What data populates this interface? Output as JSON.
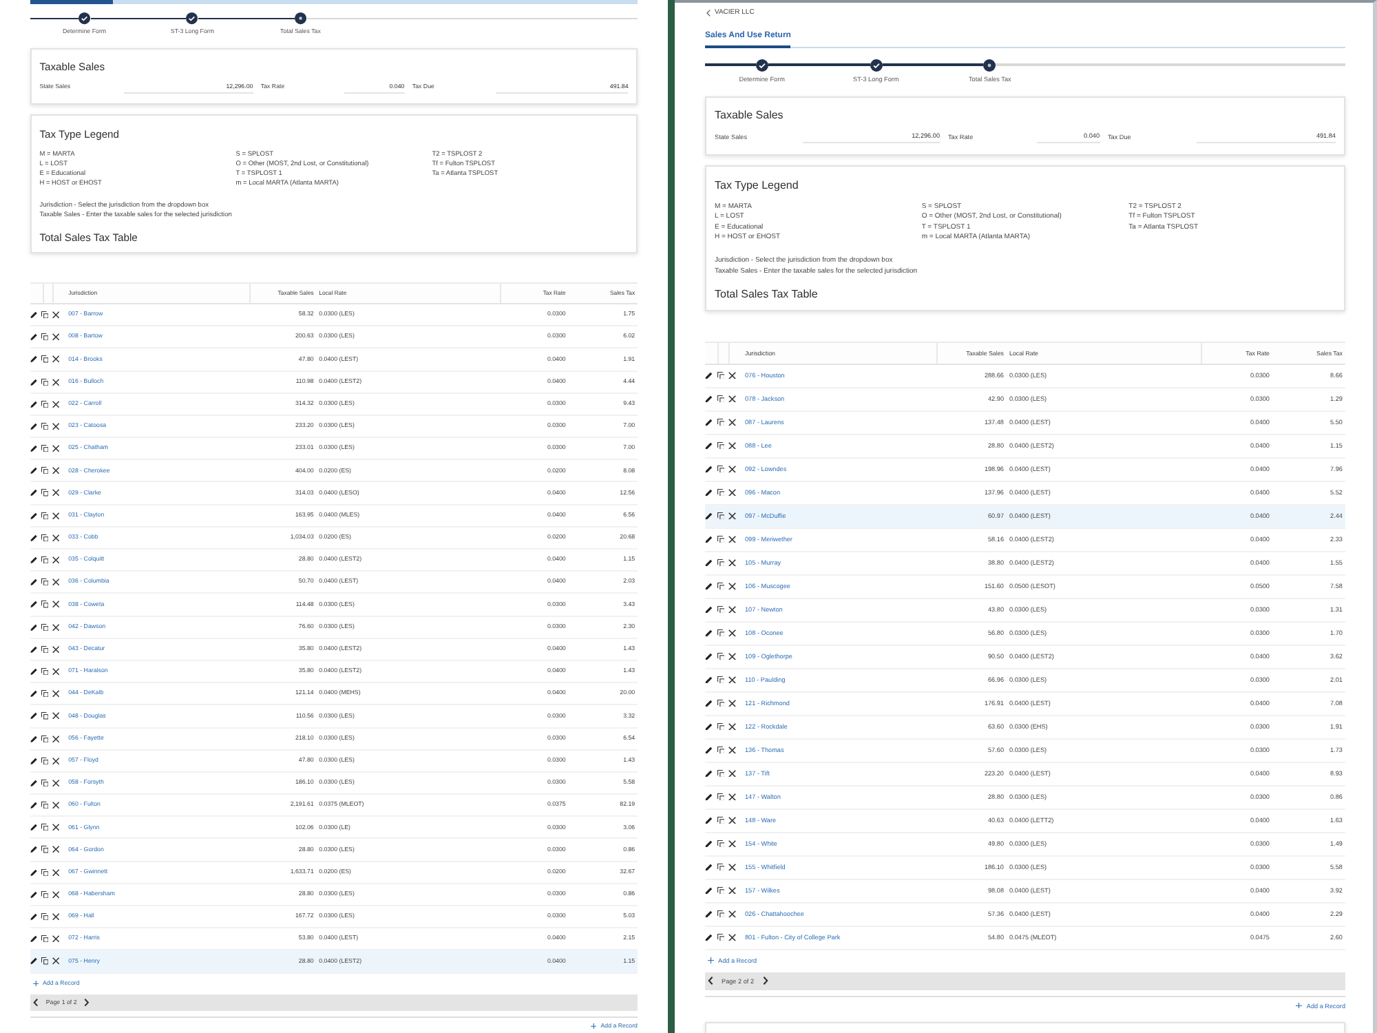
{
  "panels": [
    {
      "steps": [
        {
          "label": "Determine Form",
          "completed": true
        },
        {
          "label": "ST-3 Long Form",
          "completed": true
        },
        {
          "label": "Total Sales Tax",
          "completed": false
        }
      ],
      "taxable_sales": {
        "title": "Taxable Sales",
        "fields": [
          {
            "label": "State Sales",
            "value": "12,296.00"
          },
          {
            "label": "Tax Rate",
            "value": "0.040"
          },
          {
            "label": "Tax Due",
            "value": "491.84"
          }
        ]
      },
      "legend": {
        "title": "Tax Type Legend",
        "columns": [
          [
            "M = MARTA",
            "L = LOST",
            "E = Educational",
            "H = HOST or EHOST"
          ],
          [
            "S = SPLOST",
            "O = Other (MOST, 2nd Lost, or Constitutional)",
            "T = TSPLOST 1",
            "m = Local MARTA (Atlanta MARTA)"
          ],
          [
            "T2 = TSPLOST 2",
            "Tf = Fulton TSPLOST",
            "Ta = Atlanta TSPLOST"
          ]
        ],
        "notes": [
          "Jurisdiction - Select the jurisdiction from the dropdown box",
          "Taxable Sales - Enter the taxable sales for the selected jurisdiction"
        ],
        "table_title": "Total Sales Tax Table"
      },
      "table": {
        "columns": [
          "Jurisdiction",
          "Taxable Sales",
          "Local Rate",
          "Tax Rate",
          "Sales Tax"
        ],
        "rows": [
          {
            "jurisdiction": "007 - Barrow",
            "taxable_sales": "58.32",
            "local_rate": "0.0300 (LES)",
            "tax_rate": "0.0300",
            "sales_tax": "1.75",
            "selected": false
          },
          {
            "jurisdiction": "008 - Bartow",
            "taxable_sales": "200.63",
            "local_rate": "0.0300 (LES)",
            "tax_rate": "0.0300",
            "sales_tax": "6.02",
            "selected": false
          },
          {
            "jurisdiction": "014 - Brooks",
            "taxable_sales": "47.80",
            "local_rate": "0.0400 (LEST)",
            "tax_rate": "0.0400",
            "sales_tax": "1.91",
            "selected": false
          },
          {
            "jurisdiction": "016 - Bulloch",
            "taxable_sales": "110.98",
            "local_rate": "0.0400 (LEST2)",
            "tax_rate": "0.0400",
            "sales_tax": "4.44",
            "selected": false
          },
          {
            "jurisdiction": "022 - Carroll",
            "taxable_sales": "314.32",
            "local_rate": "0.0300 (LES)",
            "tax_rate": "0.0300",
            "sales_tax": "9.43",
            "selected": false
          },
          {
            "jurisdiction": "023 - Catoosa",
            "taxable_sales": "233.20",
            "local_rate": "0.0300 (LES)",
            "tax_rate": "0.0300",
            "sales_tax": "7.00",
            "selected": false
          },
          {
            "jurisdiction": "025 - Chatham",
            "taxable_sales": "233.01",
            "local_rate": "0.0300 (LES)",
            "tax_rate": "0.0300",
            "sales_tax": "7.00",
            "selected": false
          },
          {
            "jurisdiction": "028 - Cherokee",
            "taxable_sales": "404.00",
            "local_rate": "0.0200 (ES)",
            "tax_rate": "0.0200",
            "sales_tax": "8.08",
            "selected": false
          },
          {
            "jurisdiction": "029 - Clarke",
            "taxable_sales": "314.03",
            "local_rate": "0.0400 (LESO)",
            "tax_rate": "0.0400",
            "sales_tax": "12.56",
            "selected": false
          },
          {
            "jurisdiction": "031 - Clayton",
            "taxable_sales": "163.95",
            "local_rate": "0.0400 (MLES)",
            "tax_rate": "0.0400",
            "sales_tax": "6.56",
            "selected": false
          },
          {
            "jurisdiction": "033 - Cobb",
            "taxable_sales": "1,034.03",
            "local_rate": "0.0200 (ES)",
            "tax_rate": "0.0200",
            "sales_tax": "20.68",
            "selected": false
          },
          {
            "jurisdiction": "035 - Colquitt",
            "taxable_sales": "28.80",
            "local_rate": "0.0400 (LEST2)",
            "tax_rate": "0.0400",
            "sales_tax": "1.15",
            "selected": false
          },
          {
            "jurisdiction": "036 - Columbia",
            "taxable_sales": "50.70",
            "local_rate": "0.0400 (LEST)",
            "tax_rate": "0.0400",
            "sales_tax": "2.03",
            "selected": false
          },
          {
            "jurisdiction": "038 - Coweta",
            "taxable_sales": "114.48",
            "local_rate": "0.0300 (LES)",
            "tax_rate": "0.0300",
            "sales_tax": "3.43",
            "selected": false
          },
          {
            "jurisdiction": "042 - Dawson",
            "taxable_sales": "76.60",
            "local_rate": "0.0300 (LES)",
            "tax_rate": "0.0300",
            "sales_tax": "2.30",
            "selected": false
          },
          {
            "jurisdiction": "043 - Decatur",
            "taxable_sales": "35.80",
            "local_rate": "0.0400 (LEST2)",
            "tax_rate": "0.0400",
            "sales_tax": "1.43",
            "selected": false
          },
          {
            "jurisdiction": "071 - Haralson",
            "taxable_sales": "35.80",
            "local_rate": "0.0400 (LEST2)",
            "tax_rate": "0.0400",
            "sales_tax": "1.43",
            "selected": false
          },
          {
            "jurisdiction": "044 - DeKalb",
            "taxable_sales": "121.14",
            "local_rate": "0.0400 (MEHS)",
            "tax_rate": "0.0400",
            "sales_tax": "20.00",
            "selected": false
          },
          {
            "jurisdiction": "048 - Douglas",
            "taxable_sales": "110.56",
            "local_rate": "0.0300 (LES)",
            "tax_rate": "0.0300",
            "sales_tax": "3.32",
            "selected": false
          },
          {
            "jurisdiction": "056 - Fayette",
            "taxable_sales": "218.10",
            "local_rate": "0.0300 (LES)",
            "tax_rate": "0.0300",
            "sales_tax": "6.54",
            "selected": false
          },
          {
            "jurisdiction": "057 - Floyd",
            "taxable_sales": "47.80",
            "local_rate": "0.0300 (LES)",
            "tax_rate": "0.0300",
            "sales_tax": "1.43",
            "selected": false
          },
          {
            "jurisdiction": "058 - Forsyth",
            "taxable_sales": "186.10",
            "local_rate": "0.0300 (LES)",
            "tax_rate": "0.0300",
            "sales_tax": "5.58",
            "selected": false
          },
          {
            "jurisdiction": "060 - Fulton",
            "taxable_sales": "2,191.61",
            "local_rate": "0.0375 (MLEOT)",
            "tax_rate": "0.0375",
            "sales_tax": "82.19",
            "selected": false
          },
          {
            "jurisdiction": "061 - Glynn",
            "taxable_sales": "102.06",
            "local_rate": "0.0300 (LE)",
            "tax_rate": "0.0300",
            "sales_tax": "3.06",
            "selected": false
          },
          {
            "jurisdiction": "064 - Gordon",
            "taxable_sales": "28.80",
            "local_rate": "0.0300 (LES)",
            "tax_rate": "0.0300",
            "sales_tax": "0.86",
            "selected": false
          },
          {
            "jurisdiction": "067 - Gwinnett",
            "taxable_sales": "1,633.71",
            "local_rate": "0.0200 (ES)",
            "tax_rate": "0.0200",
            "sales_tax": "32.67",
            "selected": false
          },
          {
            "jurisdiction": "068 - Habersham",
            "taxable_sales": "28.80",
            "local_rate": "0.0300 (LES)",
            "tax_rate": "0.0300",
            "sales_tax": "0.86",
            "selected": false
          },
          {
            "jurisdiction": "069 - Hall",
            "taxable_sales": "167.72",
            "local_rate": "0.0300 (LES)",
            "tax_rate": "0.0300",
            "sales_tax": "5.03",
            "selected": false
          },
          {
            "jurisdiction": "072 - Harris",
            "taxable_sales": "53.80",
            "local_rate": "0.0400 (LEST)",
            "tax_rate": "0.0400",
            "sales_tax": "2.15",
            "selected": false
          },
          {
            "jurisdiction": "075 - Henry",
            "taxable_sales": "28.80",
            "local_rate": "0.0400 (LEST2)",
            "tax_rate": "0.0400",
            "sales_tax": "1.15",
            "selected": true
          }
        ],
        "add_link": "Add a Record",
        "pager": "Page 1 of 2"
      },
      "footer_link": "Add a Record"
    },
    {
      "back_link": "VACIER LLC",
      "tabs": [
        {
          "label": "Sales And Use Return",
          "selected": true
        }
      ],
      "steps": [
        {
          "label": "Determine Form",
          "completed": true
        },
        {
          "label": "ST-3 Long Form",
          "completed": true
        },
        {
          "label": "Total Sales Tax",
          "completed": false
        }
      ],
      "taxable_sales": {
        "title": "Taxable Sales",
        "fields": [
          {
            "label": "State Sales",
            "value": "12,296.00"
          },
          {
            "label": "Tax Rate",
            "value": "0.040"
          },
          {
            "label": "Tax Due",
            "value": "491.84"
          }
        ]
      },
      "legend": {
        "title": "Tax Type Legend",
        "columns": [
          [
            "M = MARTA",
            "L = LOST",
            "E = Educational",
            "H = HOST or EHOST"
          ],
          [
            "S = SPLOST",
            "O = Other (MOST, 2nd Lost, or Constitutional)",
            "T = TSPLOST 1",
            "m = Local MARTA (Atlanta MARTA)"
          ],
          [
            "T2 = TSPLOST 2",
            "Tf = Fulton TSPLOST",
            "Ta = Atlanta TSPLOST"
          ]
        ],
        "notes": [
          "Jurisdiction - Select the jurisdiction from the dropdown box",
          "Taxable Sales - Enter the taxable sales for the selected jurisdiction"
        ],
        "table_title": "Total Sales Tax Table"
      },
      "table": {
        "columns": [
          "Jurisdiction",
          "Taxable Sales",
          "Local Rate",
          "Tax Rate",
          "Sales Tax"
        ],
        "rows": [
          {
            "jurisdiction": "076 - Houston",
            "taxable_sales": "288.66",
            "local_rate": "0.0300 (LES)",
            "tax_rate": "0.0300",
            "sales_tax": "8.66",
            "selected": false
          },
          {
            "jurisdiction": "078 - Jackson",
            "taxable_sales": "42.90",
            "local_rate": "0.0300 (LES)",
            "tax_rate": "0.0300",
            "sales_tax": "1.29",
            "selected": false
          },
          {
            "jurisdiction": "087 - Laurens",
            "taxable_sales": "137.48",
            "local_rate": "0.0400 (LEST)",
            "tax_rate": "0.0400",
            "sales_tax": "5.50",
            "selected": false
          },
          {
            "jurisdiction": "088 - Lee",
            "taxable_sales": "28.80",
            "local_rate": "0.0400 (LEST2)",
            "tax_rate": "0.0400",
            "sales_tax": "1.15",
            "selected": false
          },
          {
            "jurisdiction": "092 - Lowndes",
            "taxable_sales": "198.96",
            "local_rate": "0.0400 (LEST)",
            "tax_rate": "0.0400",
            "sales_tax": "7.96",
            "selected": false
          },
          {
            "jurisdiction": "096 - Macon",
            "taxable_sales": "137.96",
            "local_rate": "0.0400 (LEST)",
            "tax_rate": "0.0400",
            "sales_tax": "5.52",
            "selected": false
          },
          {
            "jurisdiction": "097 - McDuffie",
            "taxable_sales": "60.97",
            "local_rate": "0.0400 (LEST)",
            "tax_rate": "0.0400",
            "sales_tax": "2.44",
            "selected": true
          },
          {
            "jurisdiction": "099 - Meriwether",
            "taxable_sales": "58.16",
            "local_rate": "0.0400 (LEST2)",
            "tax_rate": "0.0400",
            "sales_tax": "2.33",
            "selected": false
          },
          {
            "jurisdiction": "105 - Murray",
            "taxable_sales": "38.80",
            "local_rate": "0.0400 (LEST2)",
            "tax_rate": "0.0400",
            "sales_tax": "1.55",
            "selected": false
          },
          {
            "jurisdiction": "106 - Muscogee",
            "taxable_sales": "151.60",
            "local_rate": "0.0500 (LESOT)",
            "tax_rate": "0.0500",
            "sales_tax": "7.58",
            "selected": false
          },
          {
            "jurisdiction": "107 - Newton",
            "taxable_sales": "43.80",
            "local_rate": "0.0300 (LES)",
            "tax_rate": "0.0300",
            "sales_tax": "1.31",
            "selected": false
          },
          {
            "jurisdiction": "108 - Oconee",
            "taxable_sales": "56.80",
            "local_rate": "0.0300 (LES)",
            "tax_rate": "0.0300",
            "sales_tax": "1.70",
            "selected": false
          },
          {
            "jurisdiction": "109 - Oglethorpe",
            "taxable_sales": "90.50",
            "local_rate": "0.0400 (LEST2)",
            "tax_rate": "0.0400",
            "sales_tax": "3.62",
            "selected": false
          },
          {
            "jurisdiction": "110 - Paulding",
            "taxable_sales": "66.96",
            "local_rate": "0.0300 (LES)",
            "tax_rate": "0.0300",
            "sales_tax": "2.01",
            "selected": false
          },
          {
            "jurisdiction": "121 - Richmond",
            "taxable_sales": "176.91",
            "local_rate": "0.0400 (LEST)",
            "tax_rate": "0.0400",
            "sales_tax": "7.08",
            "selected": false
          },
          {
            "jurisdiction": "122 - Rockdale",
            "taxable_sales": "63.60",
            "local_rate": "0.0300 (EHS)",
            "tax_rate": "0.0300",
            "sales_tax": "1.91",
            "selected": false
          },
          {
            "jurisdiction": "136 - Thomas",
            "taxable_sales": "57.60",
            "local_rate": "0.0300 (LES)",
            "tax_rate": "0.0300",
            "sales_tax": "1.73",
            "selected": false
          },
          {
            "jurisdiction": "137 - Tift",
            "taxable_sales": "223.20",
            "local_rate": "0.0400 (LEST)",
            "tax_rate": "0.0400",
            "sales_tax": "8.93",
            "selected": false
          },
          {
            "jurisdiction": "147 - Walton",
            "taxable_sales": "28.80",
            "local_rate": "0.0300 (LES)",
            "tax_rate": "0.0300",
            "sales_tax": "0.86",
            "selected": false
          },
          {
            "jurisdiction": "148 - Ware",
            "taxable_sales": "40.63",
            "local_rate": "0.0400 (LETT2)",
            "tax_rate": "0.0400",
            "sales_tax": "1.63",
            "selected": false
          },
          {
            "jurisdiction": "154 - White",
            "taxable_sales": "49.80",
            "local_rate": "0.0300 (LES)",
            "tax_rate": "0.0300",
            "sales_tax": "1.49",
            "selected": false
          },
          {
            "jurisdiction": "155 - Whitfield",
            "taxable_sales": "186.10",
            "local_rate": "0.0300 (LES)",
            "tax_rate": "0.0300",
            "sales_tax": "5.58",
            "selected": false
          },
          {
            "jurisdiction": "157 - Wilkes",
            "taxable_sales": "98.08",
            "local_rate": "0.0400 (LEST)",
            "tax_rate": "0.0400",
            "sales_tax": "3.92",
            "selected": false
          },
          {
            "jurisdiction": "026 - Chattahoochee",
            "taxable_sales": "57.36",
            "local_rate": "0.0400 (LEST)",
            "tax_rate": "0.0400",
            "sales_tax": "2.29",
            "selected": false
          },
          {
            "jurisdiction": "801 - Fulton - City of College Park",
            "taxable_sales": "54.80",
            "local_rate": "0.0475 (MLEOT)",
            "tax_rate": "0.0475",
            "sales_tax": "2.60",
            "selected": false
          }
        ],
        "add_link": "Add a Record",
        "pager": "Page 2 of 2"
      },
      "footer_link": "Add a Record",
      "next_card": true
    }
  ]
}
